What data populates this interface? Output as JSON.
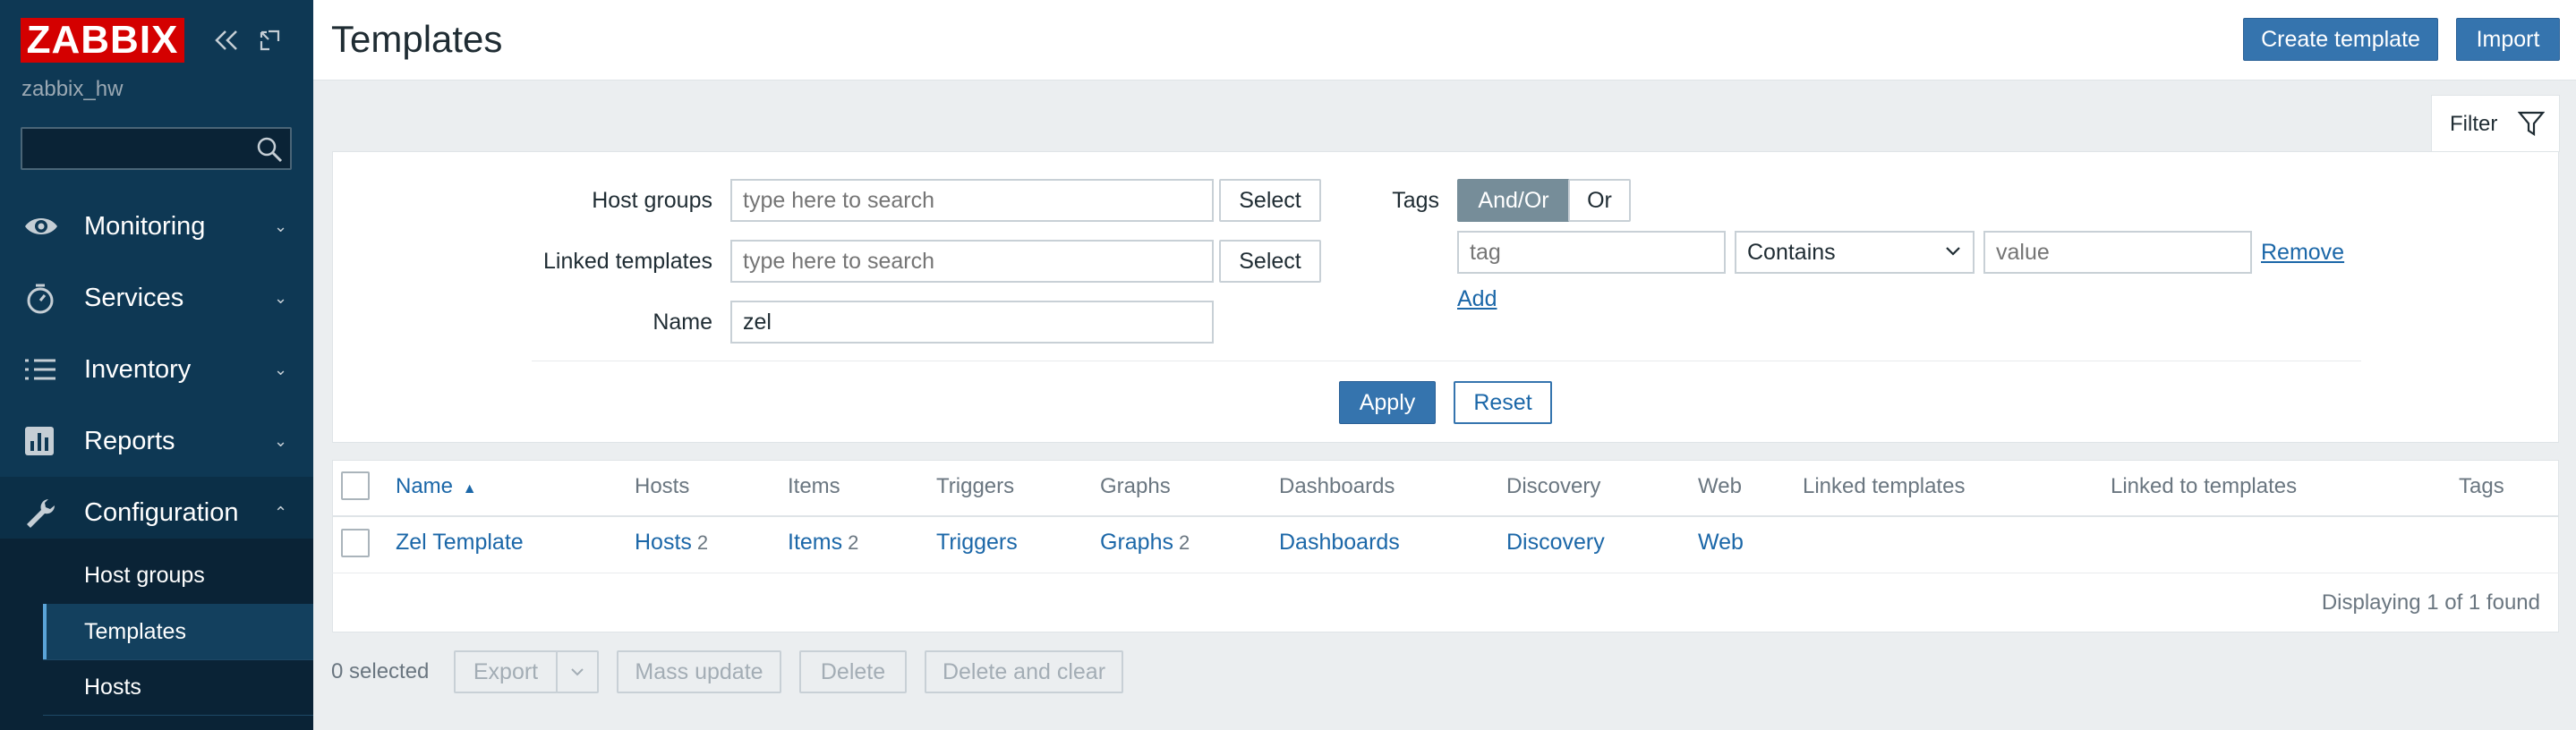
{
  "sidebar": {
    "logo": "ZABBIX",
    "server_name": "zabbix_hw",
    "search_placeholder": "",
    "menu": [
      {
        "label": "Monitoring",
        "icon": "eye-icon"
      },
      {
        "label": "Services",
        "icon": "stopwatch-icon"
      },
      {
        "label": "Inventory",
        "icon": "list-icon"
      },
      {
        "label": "Reports",
        "icon": "bar-chart-icon"
      },
      {
        "label": "Configuration",
        "icon": "wrench-icon"
      }
    ],
    "submenu": [
      {
        "label": "Host groups"
      },
      {
        "label": "Templates"
      },
      {
        "label": "Hosts"
      }
    ]
  },
  "header": {
    "title": "Templates",
    "create_label": "Create template",
    "import_label": "Import"
  },
  "filter": {
    "tab_label": "Filter",
    "host_groups_label": "Host groups",
    "host_groups_placeholder": "type here to search",
    "linked_templates_label": "Linked templates",
    "linked_templates_placeholder": "type here to search",
    "name_label": "Name",
    "name_value": "zel",
    "select_label": "Select",
    "tags_label": "Tags",
    "andor_label": "And/Or",
    "or_label": "Or",
    "tag_placeholder": "tag",
    "operator_value": "Contains",
    "value_placeholder": "value",
    "remove_label": "Remove",
    "add_label": "Add",
    "apply_label": "Apply",
    "reset_label": "Reset"
  },
  "table": {
    "columns": [
      "Name",
      "Hosts",
      "Items",
      "Triggers",
      "Graphs",
      "Dashboards",
      "Discovery",
      "Web",
      "Linked templates",
      "Linked to templates",
      "Tags"
    ],
    "sort_indicator": "▲",
    "rows": [
      {
        "name": "Zel Template",
        "hosts": "Hosts",
        "hosts_count": "2",
        "items": "Items",
        "items_count": "2",
        "triggers": "Triggers",
        "graphs": "Graphs",
        "graphs_count": "2",
        "dashboards": "Dashboards",
        "discovery": "Discovery",
        "web": "Web"
      }
    ],
    "displaying": "Displaying 1 of 1 found"
  },
  "actions": {
    "selected": "0 selected",
    "export": "Export",
    "mass_update": "Mass update",
    "delete": "Delete",
    "delete_and_clear": "Delete and clear"
  },
  "colors": {
    "sidebar_bg": "#0e3854",
    "logo_bg": "#d40000",
    "primary": "#3574ae",
    "link": "#1b67a8"
  }
}
